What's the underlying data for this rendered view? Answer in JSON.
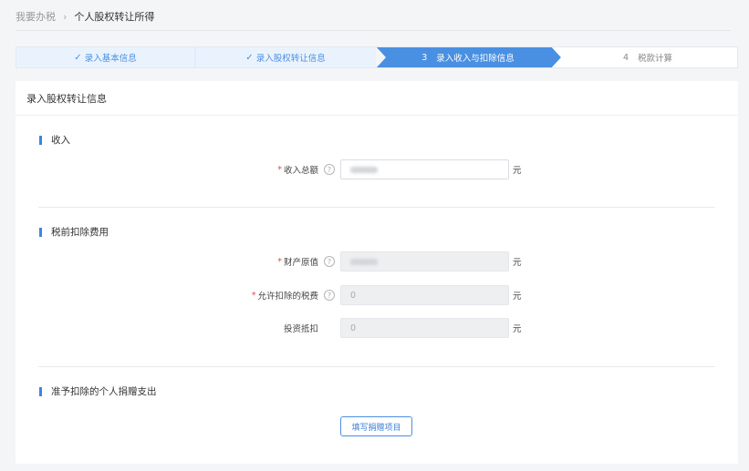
{
  "breadcrumb": {
    "parent": "我要办税",
    "separator": "›",
    "current": "个人股权转让所得"
  },
  "steps": [
    {
      "label": "录入基本信息",
      "state": "done"
    },
    {
      "label": "录入股权转让信息",
      "state": "done"
    },
    {
      "number": "3",
      "label": "录入收入与扣除信息",
      "state": "active"
    },
    {
      "number": "4",
      "label": "税款计算",
      "state": "todo"
    }
  ],
  "card": {
    "title": "录入股权转让信息"
  },
  "sections": {
    "income": {
      "title": "收入"
    },
    "deduction": {
      "title": "税前扣除费用"
    },
    "donation": {
      "title": "准予扣除的个人捐赠支出"
    }
  },
  "fields": {
    "total_income": {
      "label": "收入总额",
      "required": "*",
      "value": "",
      "unit": "元"
    },
    "original_value": {
      "label": "财产原值",
      "required": "*",
      "value": "",
      "unit": "元"
    },
    "allowed_tax": {
      "label": "允许扣除的税费",
      "required": "*",
      "value": "0",
      "unit": "元"
    },
    "investment_offset": {
      "label": "投资抵扣",
      "value": "0",
      "unit": "元"
    }
  },
  "buttons": {
    "fill_donation": "填写捐赠项目"
  },
  "icons": {
    "help": "?",
    "check": "✓"
  },
  "colors": {
    "accent": "#4A90E2",
    "required": "#E8484E",
    "done_step_bg": "#EAF3FD"
  }
}
